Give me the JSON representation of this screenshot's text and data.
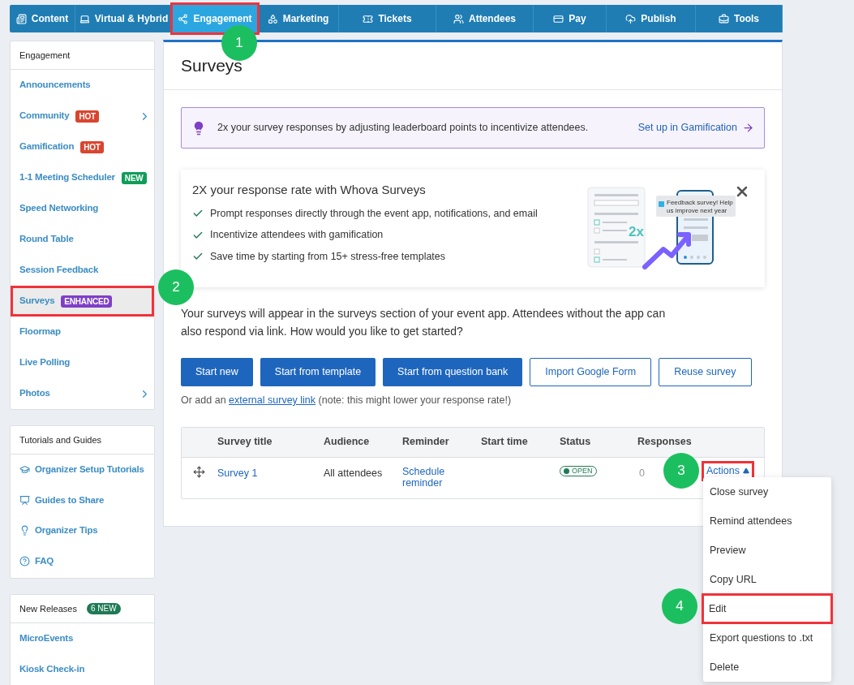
{
  "top_nav": [
    {
      "label": "Content",
      "selected": false
    },
    {
      "label": "Virtual & Hybrid",
      "selected": false
    },
    {
      "label": "Engagement",
      "selected": true,
      "highlighted": true,
      "step": "1"
    },
    {
      "label": "Marketing",
      "selected": false
    },
    {
      "label": "Tickets",
      "selected": false
    },
    {
      "label": "Attendees",
      "selected": false
    },
    {
      "label": "Pay",
      "selected": false
    },
    {
      "label": "Publish",
      "selected": false
    },
    {
      "label": "Tools",
      "selected": false
    }
  ],
  "sidebar": {
    "engagement": {
      "title": "Engagement",
      "items": [
        {
          "label": "Announcements",
          "selected": false,
          "has_submenu": false
        },
        {
          "label": "Community",
          "selected": false,
          "has_submenu": true,
          "badge": {
            "text": "HOT",
            "color": "#d9452f"
          }
        },
        {
          "label": "Gamification",
          "selected": false,
          "has_submenu": false,
          "badge": {
            "text": "HOT",
            "color": "#d9452f"
          }
        },
        {
          "label": "1-1 Meeting Scheduler",
          "selected": false,
          "has_submenu": false,
          "badge": {
            "text": "NEW",
            "color": "#0f9d58"
          }
        },
        {
          "label": "Speed Networking",
          "selected": false,
          "has_submenu": false
        },
        {
          "label": "Round Table",
          "selected": false,
          "has_submenu": false
        },
        {
          "label": "Session Feedback",
          "selected": false,
          "has_submenu": false
        },
        {
          "label": "Surveys",
          "selected": true,
          "has_submenu": false,
          "highlighted": true,
          "step": "2",
          "badge": {
            "text": "ENHANCED",
            "color": "#7e3fc7"
          }
        },
        {
          "label": "Floormap",
          "selected": false,
          "has_submenu": false
        },
        {
          "label": "Live Polling",
          "selected": false,
          "has_submenu": false
        },
        {
          "label": "Photos",
          "selected": false,
          "has_submenu": true
        }
      ]
    },
    "tutorials": {
      "title": "Tutorials and Guides",
      "items": [
        {
          "label": "Organizer Setup Tutorials"
        },
        {
          "label": "Guides to Share"
        },
        {
          "label": "Organizer Tips"
        },
        {
          "label": "FAQ"
        }
      ]
    },
    "releases": {
      "title": "New Releases",
      "badge": "6 NEW",
      "items": [
        {
          "label": "MicroEvents"
        },
        {
          "label": "Kiosk Check-in"
        }
      ]
    }
  },
  "main": {
    "title": "Surveys",
    "tip": {
      "text": "2x your survey responses by adjusting leaderboard points to incentivize attendees.",
      "link": "Set up in Gamification"
    },
    "promo": {
      "title": "2X your response rate with Whova Surveys",
      "points": [
        "Prompt responses directly through the event app, notifications, and email",
        "Incentivize attendees with gamification",
        "Save time by starting from 15+ stress-free templates"
      ],
      "illustration": {
        "badge": "2x",
        "bubble": [
          "Feedback survey! Help",
          "us improve next year"
        ]
      }
    },
    "intro": "Your surveys will appear in the surveys section of your event app. Attendees without the app can also respond via link. How would you like to get started?",
    "buttons": [
      {
        "label": "Start new",
        "kind": "primary"
      },
      {
        "label": "Start from template",
        "kind": "primary"
      },
      {
        "label": "Start from question bank",
        "kind": "primary"
      },
      {
        "label": "Import Google Form",
        "kind": "outline"
      },
      {
        "label": "Reuse survey",
        "kind": "outline"
      }
    ],
    "external": {
      "before": "Or add an",
      "link": "external survey link",
      "after": "(note: this might lower your response rate!)"
    },
    "table": {
      "columns": [
        "Survey title",
        "Audience",
        "Reminder",
        "Start time",
        "Status",
        "Responses"
      ],
      "rows": [
        {
          "title": "Survey 1",
          "audience": "All attendees",
          "reminder": [
            "Schedule",
            "reminder"
          ],
          "status": "OPEN",
          "responses": "0",
          "actions": {
            "label": "Actions",
            "expanded": true,
            "highlighted": true,
            "step": "3"
          }
        }
      ]
    },
    "actions_menu": [
      {
        "label": "Close survey",
        "highlighted": false
      },
      {
        "label": "Remind attendees",
        "highlighted": false
      },
      {
        "label": "Preview",
        "highlighted": false
      },
      {
        "label": "Copy URL",
        "highlighted": false
      },
      {
        "label": "Edit",
        "highlighted": true,
        "step": "4"
      },
      {
        "label": "Export questions to .txt",
        "highlighted": false
      },
      {
        "label": "Delete",
        "highlighted": false
      }
    ]
  }
}
